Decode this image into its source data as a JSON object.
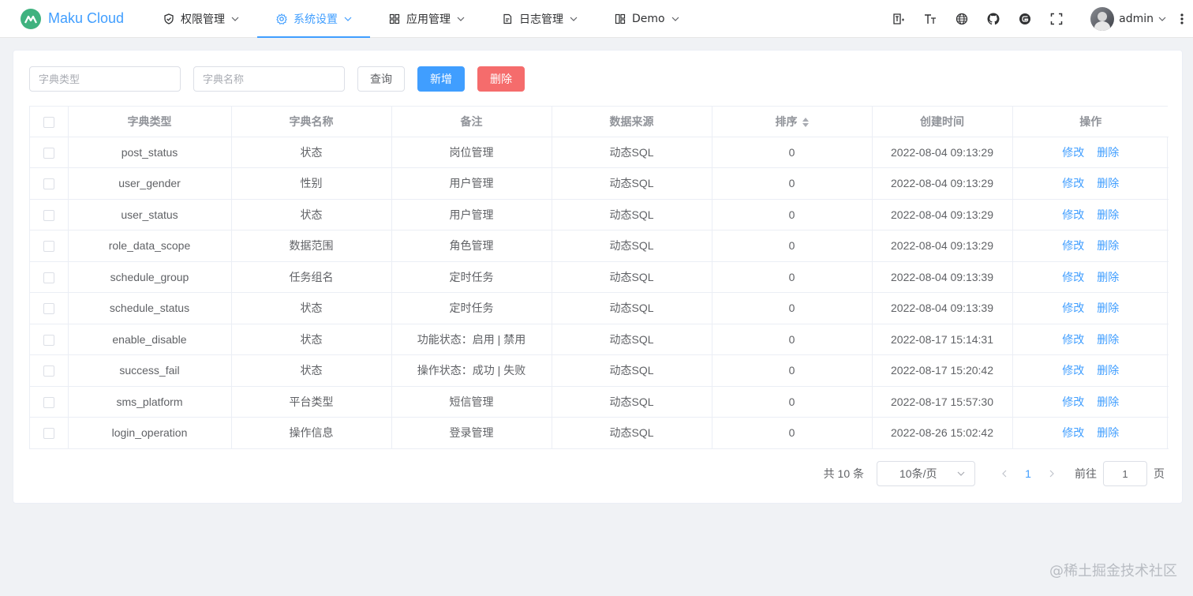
{
  "app": {
    "title": "Maku Cloud"
  },
  "nav": [
    {
      "label": "权限管理",
      "icon": "shield-check-icon"
    },
    {
      "label": "系统设置",
      "icon": "gear-icon",
      "active": true
    },
    {
      "label": "应用管理",
      "icon": "grid-icon"
    },
    {
      "label": "日志管理",
      "icon": "document-icon"
    },
    {
      "label": "Demo",
      "icon": "layout-icon"
    }
  ],
  "header": {
    "tools": [
      "component-size-icon",
      "font-size-icon",
      "language-globe-icon",
      "github-icon",
      "gitee-icon",
      "fullscreen-icon"
    ],
    "username": "admin"
  },
  "filters": {
    "dict_type_placeholder": "字典类型",
    "dict_name_placeholder": "字典名称",
    "query_label": "查询",
    "add_label": "新增",
    "delete_label": "删除"
  },
  "table": {
    "columns": [
      "字典类型",
      "字典名称",
      "备注",
      "数据来源",
      "排序",
      "创建时间",
      "操作"
    ],
    "edit_label": "修改",
    "delete_label": "删除",
    "rows": [
      {
        "type": "post_status",
        "name": "状态",
        "remark": "岗位管理",
        "source": "动态SQL",
        "sort": "0",
        "created": "2022-08-04 09:13:29"
      },
      {
        "type": "user_gender",
        "name": "性别",
        "remark": "用户管理",
        "source": "动态SQL",
        "sort": "0",
        "created": "2022-08-04 09:13:29"
      },
      {
        "type": "user_status",
        "name": "状态",
        "remark": "用户管理",
        "source": "动态SQL",
        "sort": "0",
        "created": "2022-08-04 09:13:29"
      },
      {
        "type": "role_data_scope",
        "name": "数据范围",
        "remark": "角色管理",
        "source": "动态SQL",
        "sort": "0",
        "created": "2022-08-04 09:13:29"
      },
      {
        "type": "schedule_group",
        "name": "任务组名",
        "remark": "定时任务",
        "source": "动态SQL",
        "sort": "0",
        "created": "2022-08-04 09:13:39"
      },
      {
        "type": "schedule_status",
        "name": "状态",
        "remark": "定时任务",
        "source": "动态SQL",
        "sort": "0",
        "created": "2022-08-04 09:13:39"
      },
      {
        "type": "enable_disable",
        "name": "状态",
        "remark": "功能状态：启用 | 禁用",
        "source": "动态SQL",
        "sort": "0",
        "created": "2022-08-17 15:14:31"
      },
      {
        "type": "success_fail",
        "name": "状态",
        "remark": "操作状态：成功 | 失败",
        "source": "动态SQL",
        "sort": "0",
        "created": "2022-08-17 15:20:42"
      },
      {
        "type": "sms_platform",
        "name": "平台类型",
        "remark": "短信管理",
        "source": "动态SQL",
        "sort": "0",
        "created": "2022-08-17 15:57:30"
      },
      {
        "type": "login_operation",
        "name": "操作信息",
        "remark": "登录管理",
        "source": "动态SQL",
        "sort": "0",
        "created": "2022-08-26 15:02:42"
      }
    ]
  },
  "pagination": {
    "total": "共 10 条",
    "page_size": "10条/页",
    "current": "1",
    "jump_label": "前往",
    "jump_value": "1",
    "jump_suffix": "页"
  },
  "watermark": "@稀土掘金技术社区",
  "colors": {
    "primary": "#409eff",
    "danger": "#f56c6c",
    "logo": "#3fb27f"
  }
}
